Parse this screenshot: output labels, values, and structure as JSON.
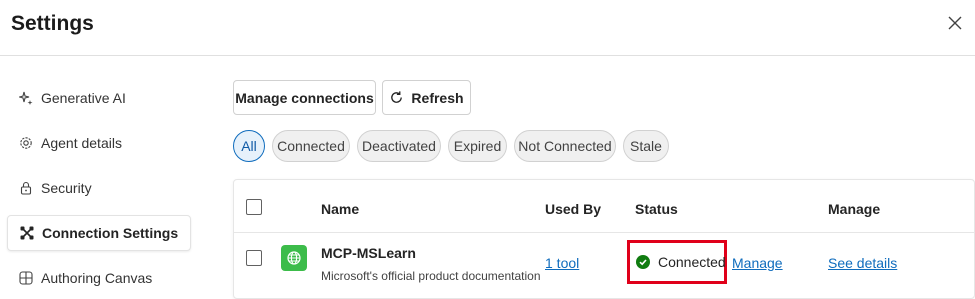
{
  "window": {
    "title": "Settings",
    "close_icon": "close-icon"
  },
  "sidebar": {
    "items": [
      {
        "label": "Generative AI",
        "icon": "sparkle-icon",
        "active": false
      },
      {
        "label": "Agent details",
        "icon": "gear-icon",
        "active": false
      },
      {
        "label": "Security",
        "icon": "lock-icon",
        "active": false
      },
      {
        "label": "Connection Settings",
        "icon": "connection-icon",
        "active": true
      },
      {
        "label": "Authoring Canvas",
        "icon": "grid-icon",
        "active": false
      }
    ]
  },
  "toolbar": {
    "manage_connections_label": "Manage connections",
    "refresh_label": "Refresh"
  },
  "filters": [
    {
      "label": "All",
      "active": true
    },
    {
      "label": "Connected",
      "active": false
    },
    {
      "label": "Deactivated",
      "active": false
    },
    {
      "label": "Expired",
      "active": false
    },
    {
      "label": "Not Connected",
      "active": false
    },
    {
      "label": "Stale",
      "active": false
    }
  ],
  "table": {
    "headers": {
      "name": "Name",
      "used_by": "Used By",
      "status": "Status",
      "manage": "Manage"
    },
    "rows": [
      {
        "name": "MCP-MSLearn",
        "description": "Microsoft's official product documentation",
        "used_by": "1 tool",
        "status": "Connected",
        "status_action": "Manage",
        "manage": "See details"
      }
    ]
  },
  "colors": {
    "accent": "#0f6cbd",
    "status_ok": "#107c10",
    "highlight": "#e0001a",
    "app_icon": "#3cbc4a"
  }
}
